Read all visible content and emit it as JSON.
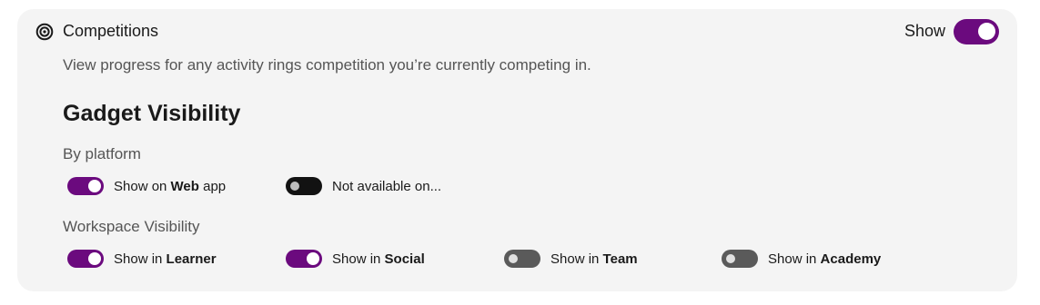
{
  "colors": {
    "accent": "#6b0a7e",
    "toggle_off_dark": "#121212",
    "toggle_off_gray": "#5a5a5a",
    "card_background": "#f4f4f4"
  },
  "header": {
    "icon": "target-icon",
    "title": "Competitions",
    "show_label": "Show",
    "show_toggle_on": true
  },
  "description": "View progress for any activity rings competition you’re currently competing in.",
  "gadget_visibility": {
    "title": "Gadget Visibility",
    "by_platform": {
      "heading": "By platform",
      "items": [
        {
          "prefix": "Show on ",
          "bold": "Web",
          "suffix": " app",
          "on": true
        },
        {
          "prefix": "Not available on...",
          "bold": "",
          "suffix": "",
          "on": false
        }
      ]
    },
    "workspace_visibility": {
      "heading": "Workspace Visibility",
      "items": [
        {
          "prefix": "Show in ",
          "bold": "Learner",
          "suffix": "",
          "on": true
        },
        {
          "prefix": "Show in ",
          "bold": "Social",
          "suffix": "",
          "on": true
        },
        {
          "prefix": "Show in ",
          "bold": "Team",
          "suffix": "",
          "on": false
        },
        {
          "prefix": "Show in ",
          "bold": "Academy",
          "suffix": "",
          "on": false
        }
      ]
    }
  }
}
